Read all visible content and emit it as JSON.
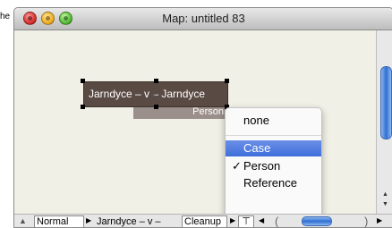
{
  "background_label": "he",
  "window": {
    "title": "Map: untitled 83"
  },
  "node": {
    "text": "Jarndyce – v –  Jarndyce",
    "type_label": "Person"
  },
  "context_menu": {
    "items": [
      {
        "label": "none",
        "checked": false,
        "highlighted": false
      },
      {
        "label": "Case",
        "checked": false,
        "highlighted": true
      },
      {
        "label": "Person",
        "checked": true,
        "highlighted": false
      },
      {
        "label": "Reference",
        "checked": false,
        "highlighted": false
      }
    ],
    "check_glyph": "✓"
  },
  "bottom_bar": {
    "style_label": "Normal",
    "note_label": "Jarndyce – v –",
    "cleanup_label": "Cleanup",
    "up_glyph": "▲",
    "arrow_glyph": "▶",
    "left_glyph": "◀",
    "paren_left": "(",
    "paren_right": ")",
    "pin_glyph": "⊤"
  },
  "icons": {
    "cursor": "cursor-icon",
    "scroll_up": "▲",
    "scroll_down": "▼"
  },
  "colors": {
    "menu_highlight": "#3f6fda",
    "node_fill": "#5a4a44",
    "canvas": "#f0f0e6"
  }
}
